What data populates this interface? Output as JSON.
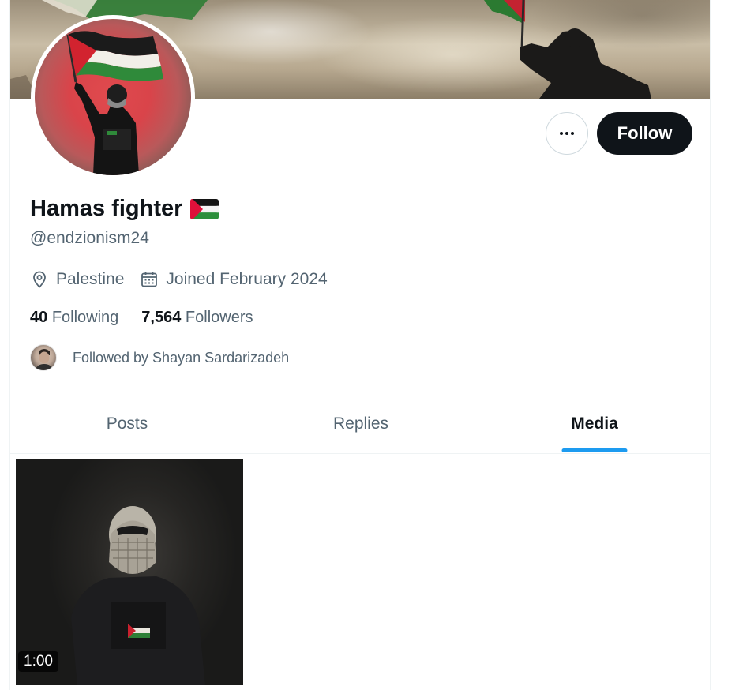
{
  "profile": {
    "display_name": "Hamas fighter",
    "handle": "@endzionism24",
    "location": "Palestine",
    "joined": "Joined February 2024",
    "following_count": "40",
    "following_label": "Following",
    "followers_count": "7,564",
    "followers_label": "Followers",
    "followed_by": "Followed by Shayan Sardarizadeh"
  },
  "actions": {
    "more_label": "•••",
    "follow_label": "Follow"
  },
  "tabs": [
    {
      "label": "Posts",
      "active": false
    },
    {
      "label": "Replies",
      "active": false
    },
    {
      "label": "Media",
      "active": true
    }
  ],
  "media": [
    {
      "duration": "1:00"
    }
  ],
  "icons": {
    "location": "location-pin-icon",
    "joined": "calendar-icon",
    "more": "more-horizontal-icon",
    "flag": "palestine-flag-emoji"
  },
  "colors": {
    "accent": "#1d9bf0",
    "follow_bg": "#0f1419",
    "secondary_text": "#536471",
    "flag_red": "#e0103a",
    "flag_green": "#2d8f3c"
  }
}
